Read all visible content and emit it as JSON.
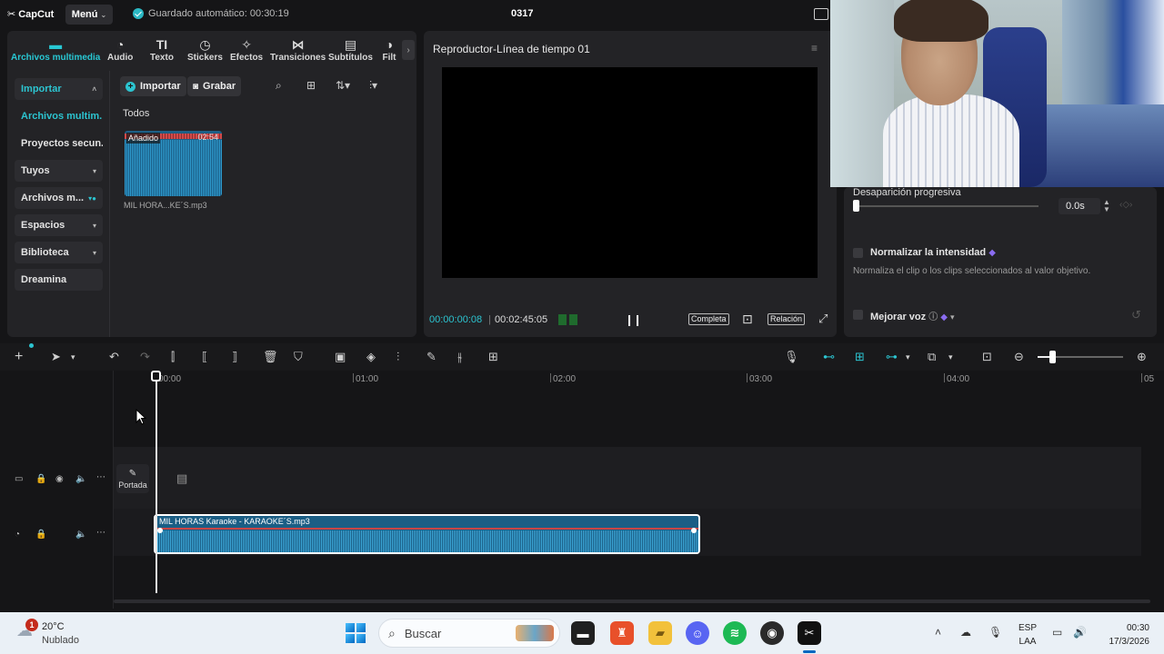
{
  "topbar": {
    "logo": "CapCut",
    "menu_label": "Menú",
    "autosave": "Guardado automático: 00:30:19",
    "project_title": "0317"
  },
  "media_tabs": [
    {
      "label": "Archivos multimedia",
      "icon": "media-icon",
      "active": true
    },
    {
      "label": "Audio",
      "icon": "audio-icon"
    },
    {
      "label": "Texto",
      "icon": "text-icon"
    },
    {
      "label": "Stickers",
      "icon": "sticker-icon"
    },
    {
      "label": "Efectos",
      "icon": "effects-icon"
    },
    {
      "label": "Transiciones",
      "icon": "transitions-icon"
    },
    {
      "label": "Subtítulos",
      "icon": "subtitles-icon"
    },
    {
      "label": "Filt",
      "icon": "filters-icon"
    }
  ],
  "sidebar": {
    "items": [
      {
        "label": "Importar"
      },
      {
        "label": "Archivos multim..."
      },
      {
        "label": "Proyectos secun..."
      },
      {
        "label": "Tuyos"
      },
      {
        "label": "Archivos m..."
      },
      {
        "label": "Espacios"
      },
      {
        "label": "Biblioteca"
      },
      {
        "label": "Dreamina"
      }
    ]
  },
  "media": {
    "import_label": "Importar",
    "record_label": "Grabar",
    "filter_label": "Todos",
    "item": {
      "badge": "Añadido",
      "duration": "02:54",
      "name": "MIL HORA...KE´S.mp3"
    }
  },
  "player": {
    "title": "Reproductor-Línea de tiempo 01",
    "current_time": "00:00:00:08",
    "total_time": "00:02:45:05",
    "full_label": "Completa",
    "ratio_label": "Relación"
  },
  "props": {
    "fade_label": "Desaparición progresiva",
    "fade_value": "0.0s",
    "fade_level": 0,
    "normalize_label": "Normalizar la intensidad",
    "normalize_desc": "Normaliza el clip o los clips seleccionados al valor objetivo.",
    "voice_label": "Mejorar voz"
  },
  "timeline": {
    "ruler": [
      "00:00",
      "01:00",
      "02:00",
      "03:00",
      "04:00",
      "05"
    ],
    "cover_label": "Portada",
    "audio_clip_label": "MIL HORAS Karaoke - KARAOKE´S.mp3"
  },
  "taskbar": {
    "temp": "20°C",
    "weather": "Nublado",
    "weather_badge": "1",
    "search_placeholder": "Buscar",
    "lang_line1": "ESP",
    "lang_line2": "LAA",
    "time": "00:30",
    "date": "17/3/2026"
  },
  "colors": {
    "accent": "#2cc4d0",
    "panel": "#232326",
    "background": "#151517"
  }
}
